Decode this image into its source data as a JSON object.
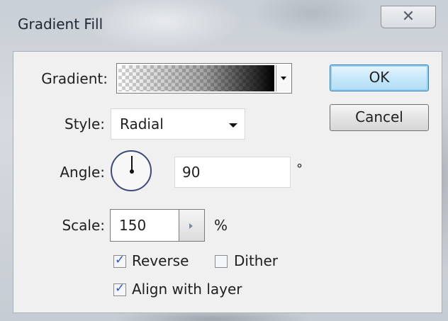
{
  "window": {
    "title": "Gradient Fill",
    "close_glyph": "✕"
  },
  "form": {
    "gradient_label": "Gradient:",
    "style_label": "Style:",
    "style_value": "Radial",
    "angle_label": "Angle:",
    "angle_value": "90",
    "angle_unit": "°",
    "scale_label": "Scale:",
    "scale_value": "150",
    "scale_unit": "%",
    "reverse_label": "Reverse",
    "reverse_checked": true,
    "dither_label": "Dither",
    "dither_checked": false,
    "align_label": "Align with layer",
    "align_checked": true
  },
  "buttons": {
    "ok_label": "OK",
    "cancel_label": "Cancel"
  },
  "colors": {
    "default_button_border": "#3c7fb1",
    "dial_border": "#3d4a7a"
  }
}
